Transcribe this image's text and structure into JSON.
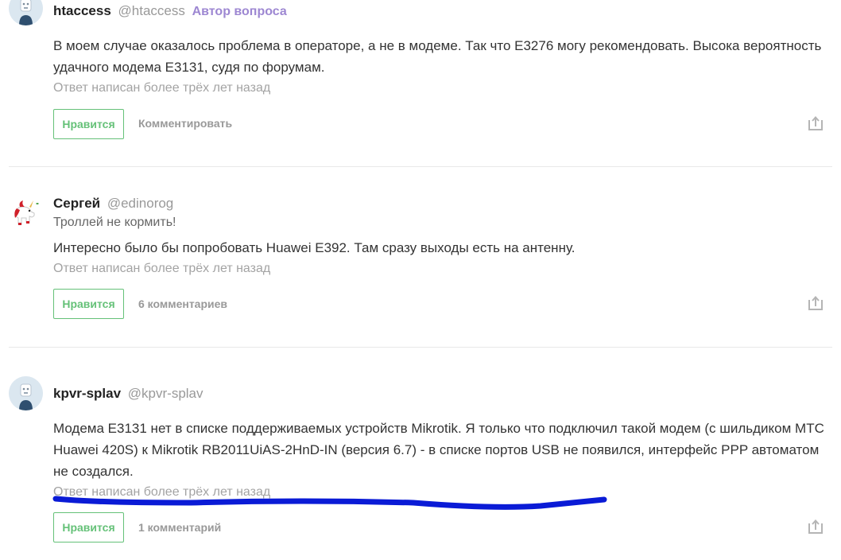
{
  "answers": [
    {
      "author_name": "htaccess",
      "author_nick": "@htaccess",
      "author_badge": "Автор вопроса",
      "subtitle": "",
      "text": "В моем случае оказалось проблема в операторе, а не в модеме. Так что E3276 могу рекомендовать. Высока вероятность удачного модема E3131, судя по форумам.",
      "meta": "Ответ написан более трёх лет назад",
      "like_label": "Нравится",
      "comment_label": "Комментировать",
      "avatar_icon": "default-user-avatar-icon"
    },
    {
      "author_name": "Сергей",
      "author_nick": "@edinorog",
      "author_badge": "",
      "subtitle": "Троллей не кормить!",
      "text": "Интересно было бы попробовать Huawei E392. Там сразу выходы есть на антенну.",
      "meta": "Ответ написан более трёх лет назад",
      "like_label": "Нравится",
      "comment_label": "6 комментариев",
      "avatar_icon": "unicorn-avatar-icon"
    },
    {
      "author_name": "kpvr-splav",
      "author_nick": "@kpvr-splav",
      "author_badge": "",
      "subtitle": "",
      "text": "Модема E3131 нет в списке поддерживаемых устройств Mikrotik. Я только что подключил такой модем (с шильдиком МТС Huawei 420S) к Mikrotik RB2011UiAS-2HnD-IN (версия 6.7) - в списке портов USB не появился, интерфейс PPP автоматом не создался.",
      "meta": "Ответ написан более трёх лет назад",
      "like_label": "Нравится",
      "comment_label": "1 комментарий",
      "avatar_icon": "default-user-avatar-icon"
    }
  ],
  "colors": {
    "like_green": "#65c178",
    "author_badge": "#9d87d2",
    "scribble_blue": "#0a1bd6"
  },
  "icons": {
    "share": "share-icon"
  }
}
